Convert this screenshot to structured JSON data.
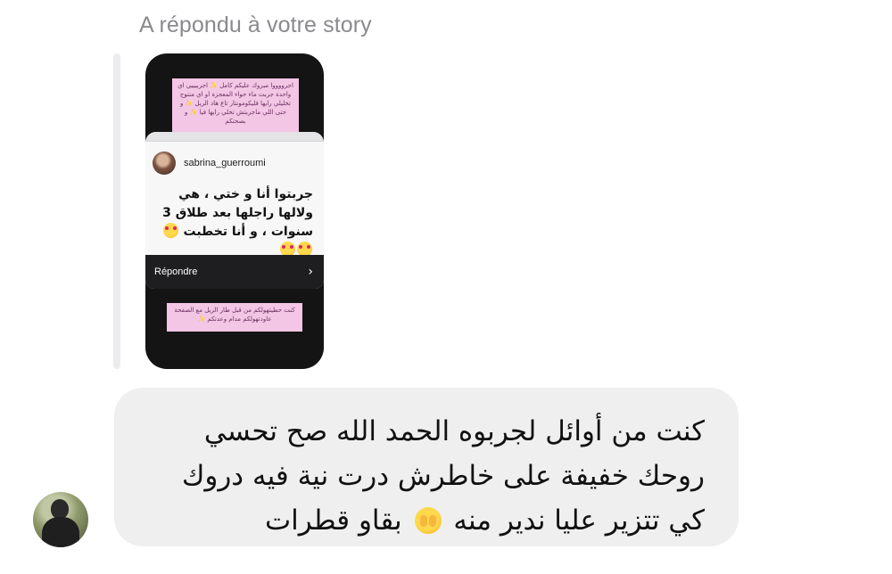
{
  "header": {
    "reply_context": "A répondu à votre story"
  },
  "story": {
    "sticker_top": "اجرووووا مبروك عليكم كامل ✨ اجربيييي اي واحدة جربت ماء حواء المعجزة او اي منتوج تخليلي رايها فليكومونتار تاع هاد الريل ✨ و حتى اللي ماجربتش تخلي رايها فيا ✨ و بصحتكم",
    "comment": {
      "username": "sabrina_guerroumi",
      "text": "جربتوا أنا و ختي ، هي ولالها راجلها بعد طلاق 3 سنوات ، و أنا تخطبت",
      "reply_label": "Répondre",
      "reply_chevron": "›"
    },
    "sticker_bottom": "كنت حطيتهولكم من قبل طار الريل مع الصفحة عاودتهولكم مدام وعدتكم ✨"
  },
  "message": {
    "line1": "كنت من أوائل لجربوه الحمد الله صح تحسي",
    "line2": "روحك خفيفة  على خاطرش درت نية فيه دروك",
    "line3": "بقاو قطرات",
    "line3_end": "كي تتزير عليا ندير منه"
  },
  "icons": {
    "comment_emoji": "smiling-face-with-hearts-icon",
    "message_emoji": "face-with-hand-over-mouth-icon"
  }
}
